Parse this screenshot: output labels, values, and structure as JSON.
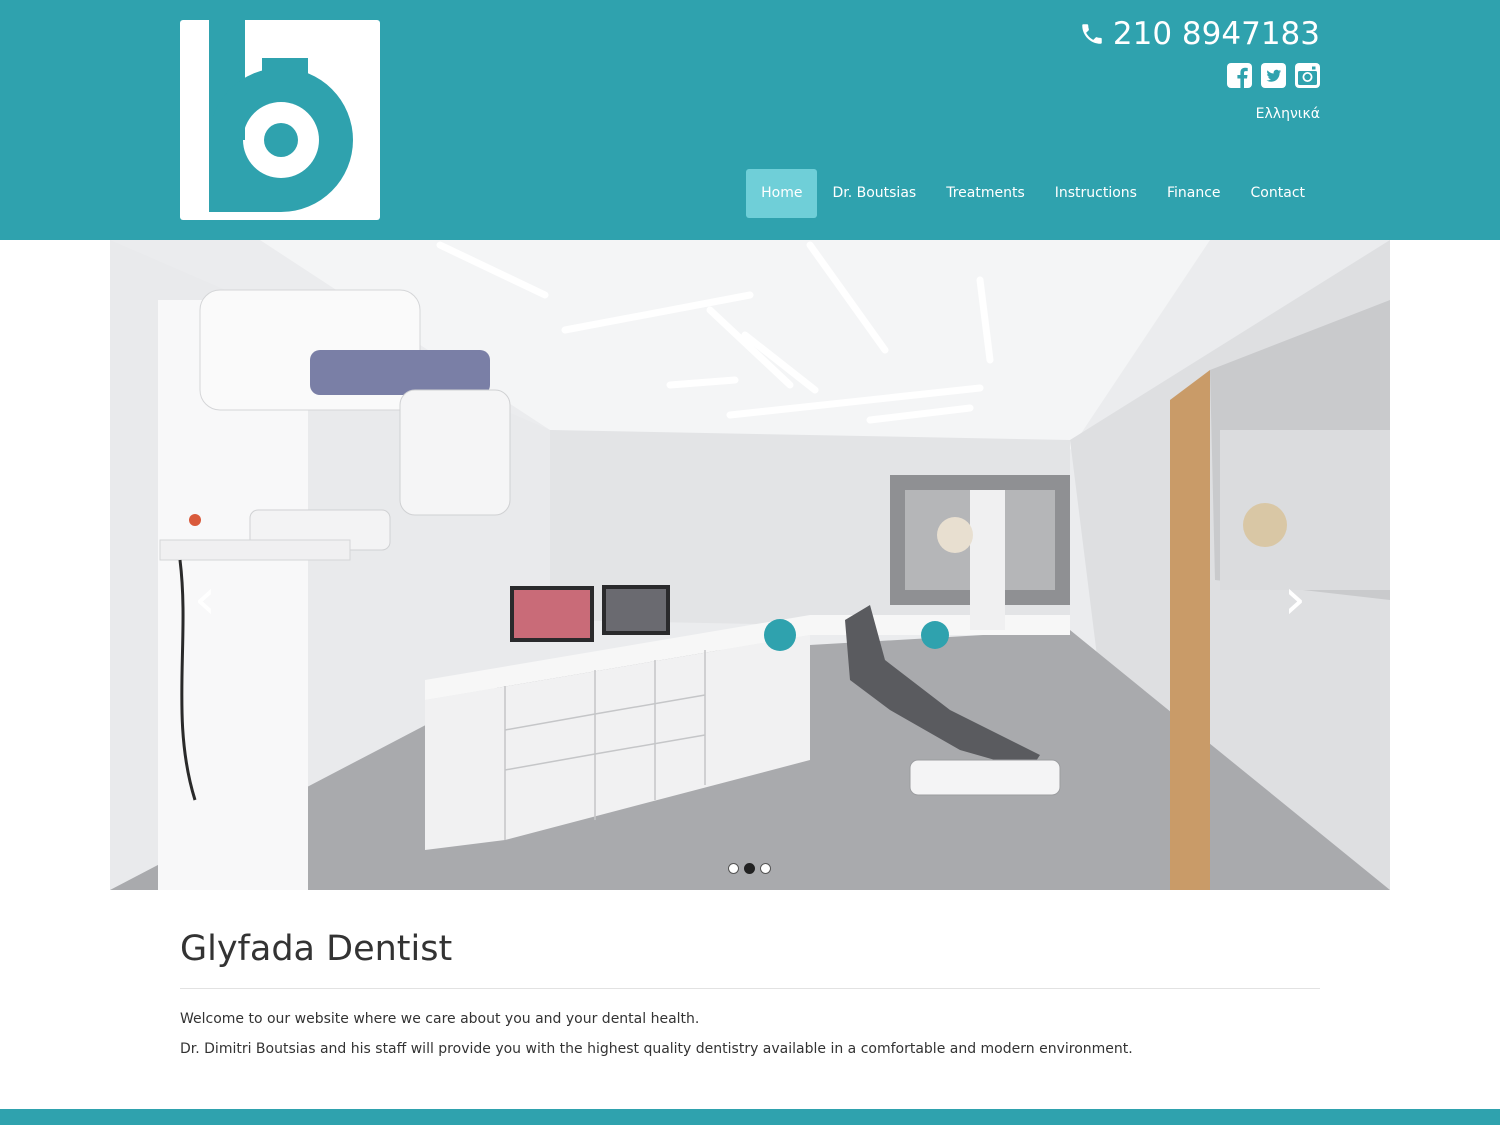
{
  "header": {
    "phone": "210 8947183",
    "language": "Ελληνικά",
    "social": [
      {
        "icon": "facebook-square-icon"
      },
      {
        "icon": "twitter-square-icon"
      },
      {
        "icon": "instagram-icon"
      }
    ],
    "nav": [
      {
        "label": "Home",
        "active": true
      },
      {
        "label": "Dr. Boutsias"
      },
      {
        "label": "Treatments"
      },
      {
        "label": "Instructions"
      },
      {
        "label": "Finance"
      },
      {
        "label": "Contact"
      }
    ]
  },
  "slider": {
    "prev": "‹",
    "next": "›",
    "slide_count": 3,
    "active_slide": 2
  },
  "content": {
    "title": "Glyfada Dentist",
    "paragraph1": "Welcome to our website where we care about you and your dental health.",
    "paragraph2": "Dr. Dimitri Boutsias and his staff  will provide you with the highest quality dentistry available in a comfortable and modern environment."
  },
  "colors": {
    "brand": "#2fa2ae",
    "nav_active": "#6fcfd8"
  }
}
